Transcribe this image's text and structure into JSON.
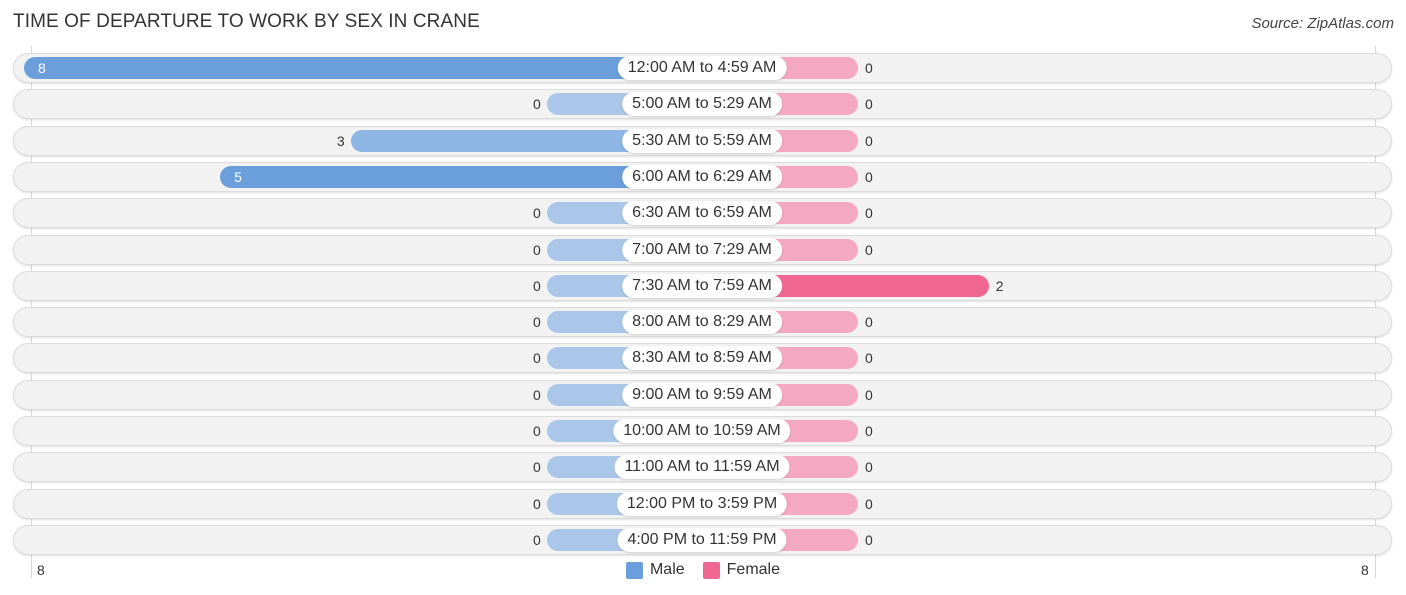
{
  "header": {
    "title": "TIME OF DEPARTURE TO WORK BY SEX IN CRANE",
    "source": "Source: ZipAtlas.com"
  },
  "colors": {
    "male": "#6a9fdc",
    "male_light": "#aac7ea",
    "female": "#f06792",
    "female_light": "#f5a8c2"
  },
  "legend": {
    "male": "Male",
    "female": "Female"
  },
  "axis": {
    "left_tick": "8",
    "right_tick": "8"
  },
  "chart_data": {
    "type": "bar",
    "orientation": "horizontal-diverging",
    "title": "TIME OF DEPARTURE TO WORK BY SEX IN CRANE",
    "categories": [
      "12:00 AM to 4:59 AM",
      "5:00 AM to 5:29 AM",
      "5:30 AM to 5:59 AM",
      "6:00 AM to 6:29 AM",
      "6:30 AM to 6:59 AM",
      "7:00 AM to 7:29 AM",
      "7:30 AM to 7:59 AM",
      "8:00 AM to 8:29 AM",
      "8:30 AM to 8:59 AM",
      "9:00 AM to 9:59 AM",
      "10:00 AM to 10:59 AM",
      "11:00 AM to 11:59 AM",
      "12:00 PM to 3:59 PM",
      "4:00 PM to 11:59 PM"
    ],
    "series": [
      {
        "name": "Male",
        "values": [
          8,
          0,
          3,
          5,
          0,
          0,
          0,
          0,
          0,
          0,
          0,
          0,
          0,
          0
        ]
      },
      {
        "name": "Female",
        "values": [
          0,
          0,
          0,
          0,
          0,
          0,
          2,
          0,
          0,
          0,
          0,
          0,
          0,
          0
        ]
      }
    ],
    "xlim": [
      -8,
      8
    ],
    "xtick_labels": [
      "8",
      "8"
    ],
    "legend_position": "bottom-center",
    "grid": false
  }
}
